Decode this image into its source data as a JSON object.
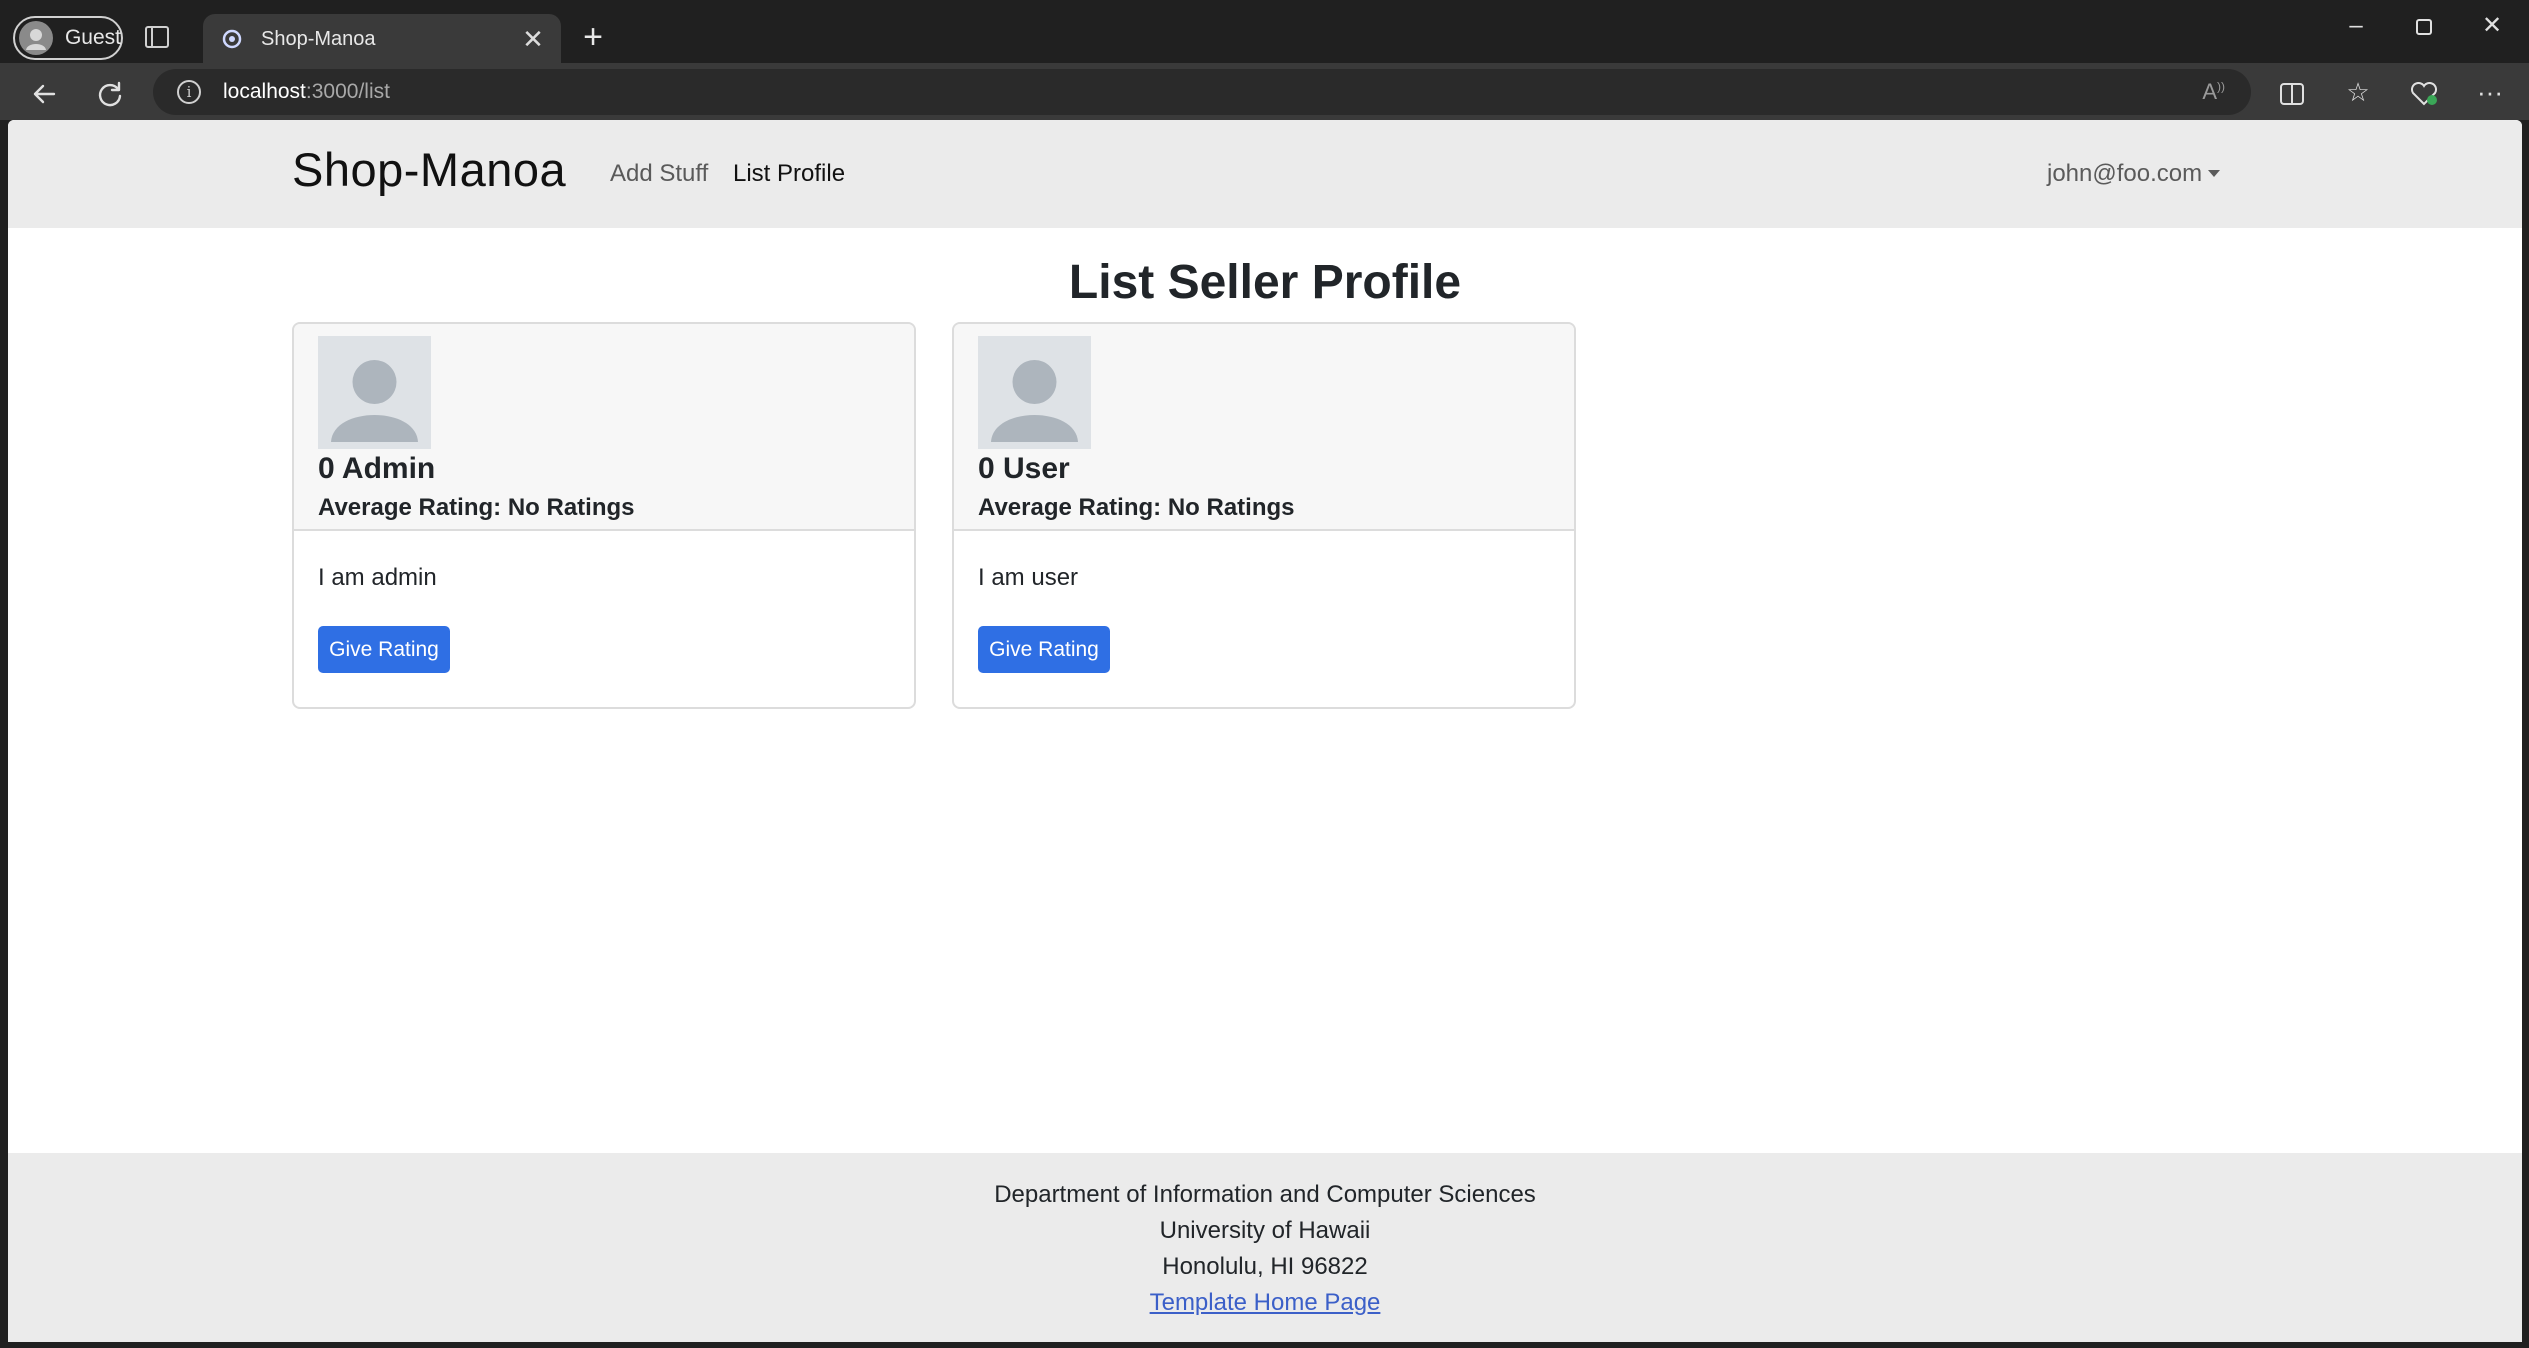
{
  "browser": {
    "profile_label": "Guest",
    "tab_title": "Shop-Manoa",
    "url_host": "localhost",
    "url_path": ":3000/list"
  },
  "navbar": {
    "brand": "Shop-Manoa",
    "links": [
      {
        "label": "Add Stuff"
      },
      {
        "label": "List Profile"
      }
    ],
    "user_email": "john@foo.com"
  },
  "page": {
    "title": "List Seller Profile"
  },
  "profiles": [
    {
      "name": "0 Admin",
      "rating": "Average Rating: No Ratings",
      "description": "I am admin",
      "button_label": "Give Rating"
    },
    {
      "name": "0 User",
      "rating": "Average Rating: No Ratings",
      "description": "I am user",
      "button_label": "Give Rating"
    }
  ],
  "footer": {
    "line1": "Department of Information and Computer Sciences",
    "line2": "University of Hawaii",
    "line3": "Honolulu, HI 96822",
    "link_label": "Template Home Page"
  },
  "colors": {
    "primary_button": "#2f6fe4",
    "navbar_bg": "#ebebeb",
    "footer_link": "#3b5fc8"
  },
  "icons": [
    "guest-avatar-icon",
    "tab-actions-icon",
    "tab-favicon",
    "close-icon",
    "new-tab-icon",
    "minimize-icon",
    "maximize-icon",
    "window-close-icon",
    "back-icon",
    "refresh-icon",
    "site-info-icon",
    "read-aloud-icon",
    "split-screen-icon",
    "favorites-icon",
    "browser-essentials-icon",
    "more-menu-icon",
    "user-placeholder-icon"
  ]
}
